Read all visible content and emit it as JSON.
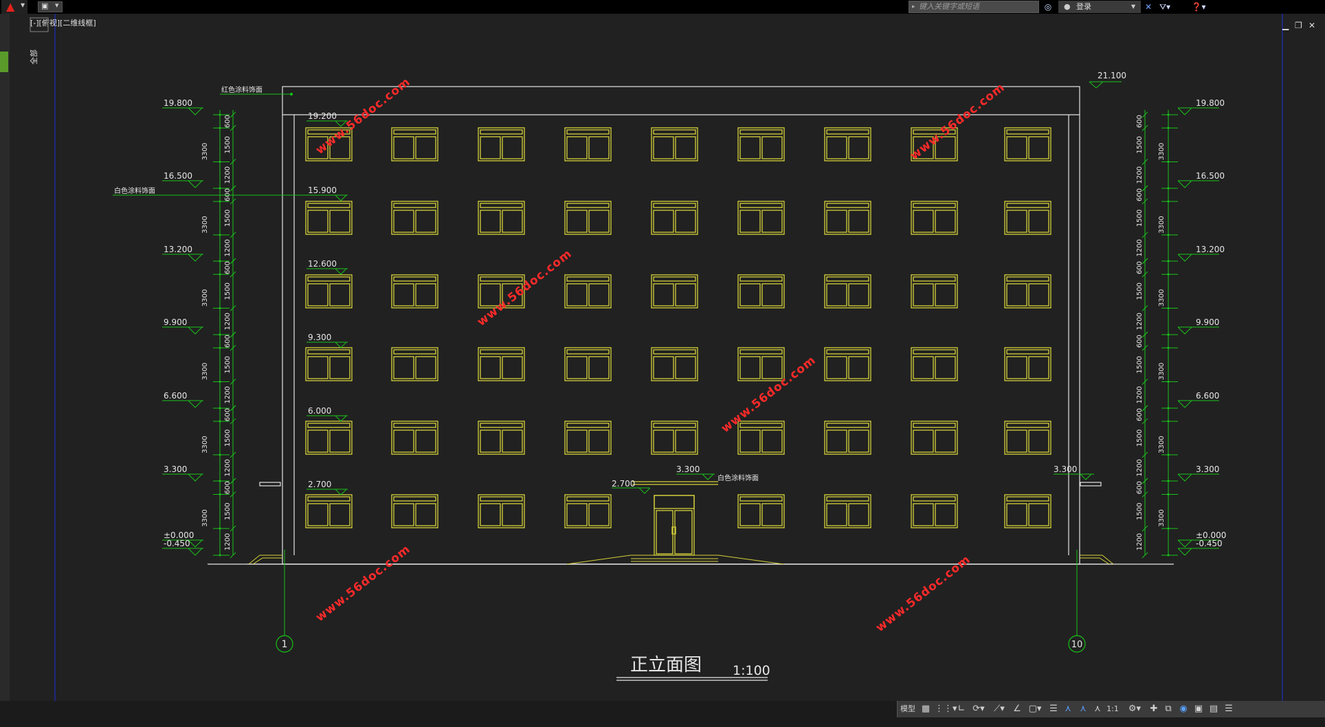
{
  "title_bar": {
    "search_placeholder": "键入关键字或短语",
    "login_label": "登录"
  },
  "viewport_label": "[-][俯视][二维线框]",
  "drawing": {
    "title": "正立面图",
    "scale": "1:100",
    "axis_left": "1",
    "axis_right": "10",
    "top_elevation": "21.100",
    "left_dims": [
      "600",
      "1500",
      "1200",
      "600",
      "1500",
      "1200",
      "600",
      "1500",
      "1200",
      "600",
      "1500",
      "1200",
      "600",
      "1500",
      "1200",
      "600",
      "1500",
      "1200"
    ],
    "floor_dims": [
      "3300",
      "3300",
      "3300",
      "3300",
      "3300",
      "3300"
    ],
    "side_levels": [
      "19.800",
      "16.500",
      "13.200",
      "9.900",
      "6.600",
      "3.300",
      "±0.000",
      "-0.450"
    ],
    "sill_levels": [
      "19.200",
      "15.900",
      "12.600",
      "9.300",
      "6.000",
      "2.700"
    ],
    "entrance_left": "2.700",
    "entrance_right": "3.300",
    "canopy_right": "3.300",
    "note_red": "红色涂料饰面",
    "note_white": "白色涂料饰面",
    "note_entrance": "白色涂料饰面",
    "watermark": "www.56doc.com",
    "colors": {
      "background": "#212121",
      "outline": "#ffffff",
      "windows": "#d6d23a",
      "dimensions": "#19c219",
      "watermark": "#ff2a2a"
    }
  },
  "statusbar": {
    "model_label": "模型",
    "scale_label": "1:1"
  }
}
